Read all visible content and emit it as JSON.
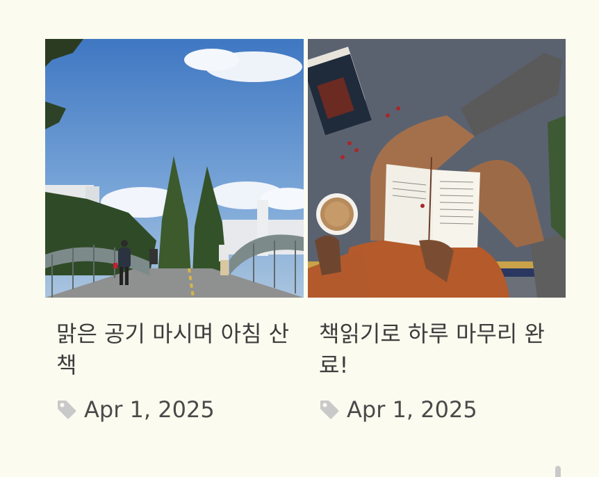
{
  "posts": [
    {
      "title": "맑은 공기 마시며 아침 산책",
      "date": "Apr 1, 2025",
      "image_icon": "walk-bridge-photo",
      "tag_icon": "tag-icon"
    },
    {
      "title": "책읽기로 하루 마무리 완료!",
      "date": "Apr 1, 2025",
      "image_icon": "reading-book-photo",
      "tag_icon": "tag-icon"
    }
  ],
  "colors": {
    "background": "#fbfbef",
    "text": "#3c3c3c",
    "tag_icon": "#c9c9c9",
    "sky": "#4f86c8",
    "blanket": "#5b6371",
    "sweater": "#b55a2a"
  }
}
